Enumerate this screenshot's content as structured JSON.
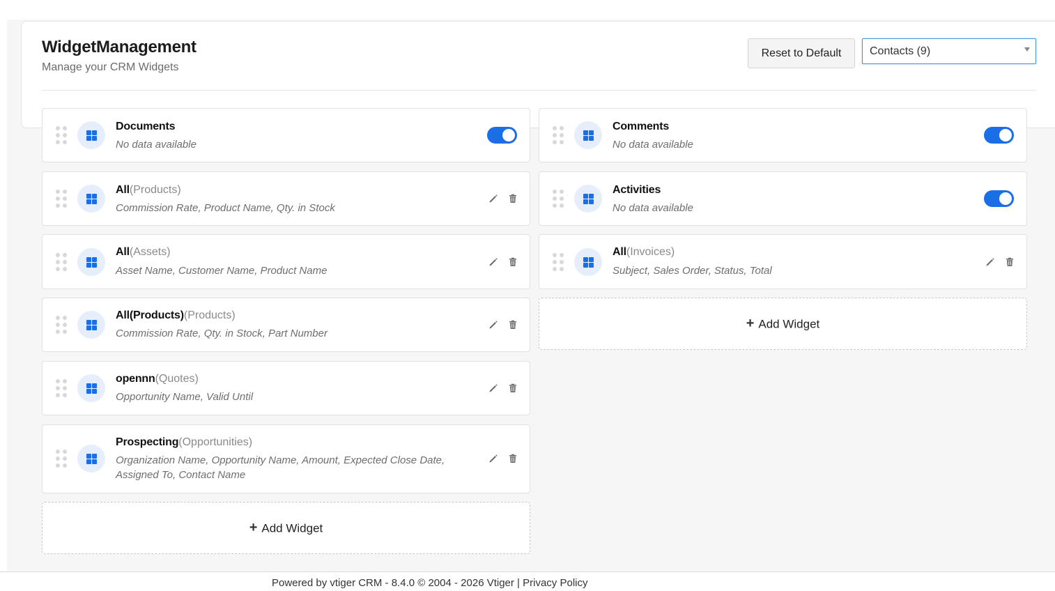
{
  "header": {
    "title": "WidgetManagement",
    "subtitle": "Manage your CRM Widgets",
    "reset_label": "Reset to Default",
    "module_select": {
      "selected": "Contacts (9)"
    }
  },
  "left_widgets": [
    {
      "name": "Documents",
      "module": "",
      "desc": "No data available",
      "type": "toggle",
      "enabled": true
    },
    {
      "name": "All",
      "module": "(Products)",
      "desc": "Commission Rate, Product Name, Qty. in Stock",
      "type": "custom"
    },
    {
      "name": "All",
      "module": "(Assets)",
      "desc": "Asset Name, Customer Name, Product Name",
      "type": "custom"
    },
    {
      "name": "All(Products)",
      "module": "(Products)",
      "desc": "Commission Rate, Qty. in Stock, Part Number",
      "type": "custom"
    },
    {
      "name": "opennn",
      "module": "(Quotes)",
      "desc": "Opportunity Name, Valid Until",
      "type": "custom"
    },
    {
      "name": "Prospecting",
      "module": "(Opportunities)",
      "desc": "Organization Name, Opportunity Name, Amount, Expected Close Date, Assigned To, Contact Name",
      "type": "custom"
    }
  ],
  "right_widgets": [
    {
      "name": "Comments",
      "module": "",
      "desc": "No data available",
      "type": "toggle",
      "enabled": true
    },
    {
      "name": "Activities",
      "module": "",
      "desc": "No data available",
      "type": "toggle",
      "enabled": true
    },
    {
      "name": "All",
      "module": "(Invoices)",
      "desc": "Subject, Sales Order, Status, Total",
      "type": "custom"
    }
  ],
  "add_widget": {
    "plus": "+",
    "label": "Add Widget"
  },
  "icons": {
    "drag": "drag-handle-icon",
    "widget": "widget-grid-icon",
    "edit": "pencil-icon",
    "delete": "trash-icon"
  },
  "colors": {
    "accent": "#1a6ee6",
    "icon_bg": "#e6eefb"
  },
  "footer": {
    "powered": "Powered by vtiger CRM - 8.4.0  © 2004 - 2026  ",
    "vtiger": "Vtiger",
    "sep": " |  ",
    "privacy": "Privacy Policy"
  }
}
